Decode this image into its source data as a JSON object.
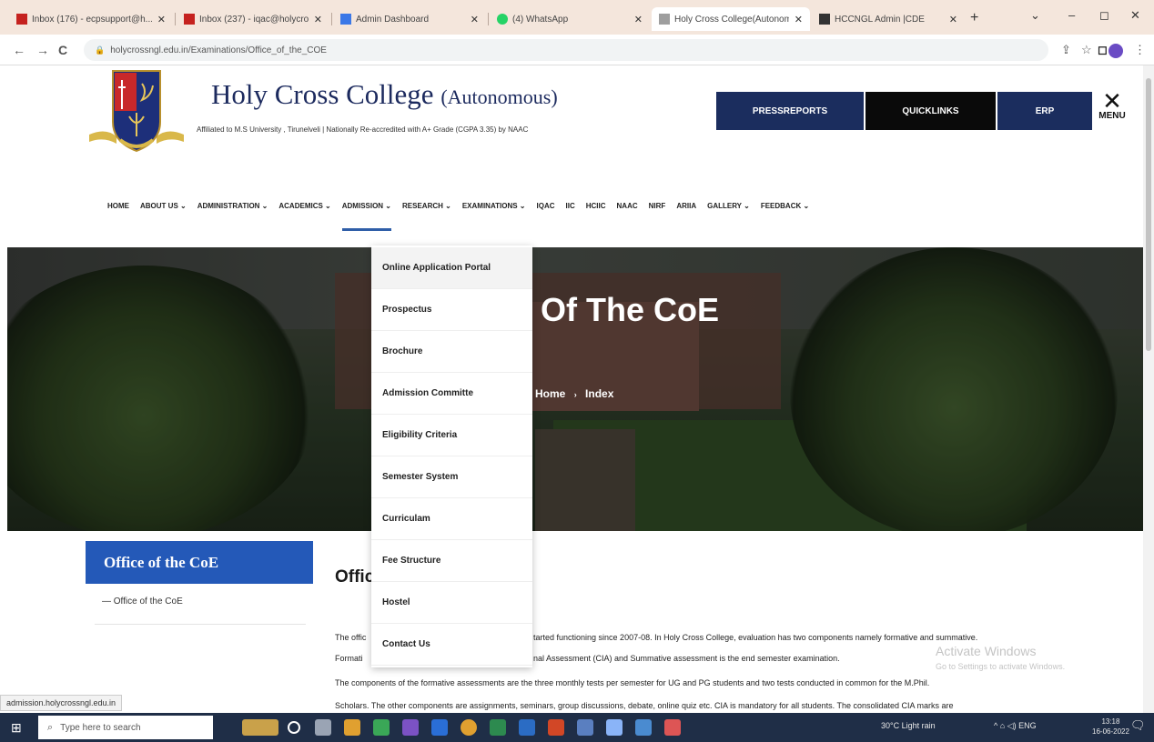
{
  "browser": {
    "tabs": [
      {
        "title": "Inbox (176) - ecpsupport@h...",
        "favicon_color": "#c5221f",
        "active": false
      },
      {
        "title": "Inbox (237) - iqac@holycross...",
        "favicon_color": "#c5221f",
        "active": false
      },
      {
        "title": "Admin Dashboard",
        "favicon_color": "#3b78e7",
        "active": false
      },
      {
        "title": "(4) WhatsApp",
        "favicon_color": "#25d366",
        "active": false
      },
      {
        "title": "Holy Cross College(Autonom...",
        "favicon_color": "#9e9e9e",
        "active": true
      },
      {
        "title": "HCCNGL Admin |CDE",
        "favicon_color": "#333333",
        "active": false
      }
    ],
    "tab_close": "✕",
    "new_tab": "+",
    "window_controls": {
      "dropdown": "⌄",
      "minimize": "–",
      "maximize": "◻",
      "close": "✕"
    },
    "nav": {
      "back": "←",
      "forward": "→",
      "reload": "C"
    },
    "url": "holycrossngl.edu.in/Examinations/Office_of_the_COE",
    "status_url": "admission.holycrossngl.edu.in"
  },
  "site": {
    "title_main": "Holy Cross College",
    "title_suffix": "(Autonomous)",
    "affiliation": "Affiliated to M.S University , Tirunelveli | Nationally Re-accredited with A+ Grade (CGPA 3.35) by NAAC",
    "top_buttons": [
      "PRESSREPORTS",
      "QUICKLINKS",
      "ERP"
    ],
    "top_button_colors": [
      "#1b2d5e",
      "#0a0a0a",
      "#1b2d5e"
    ],
    "menu_icon": "✕",
    "menu_label": "MENU"
  },
  "nav": {
    "items": [
      "HOME",
      "ABOUT US ⌄",
      "ADMINISTRATION ⌄",
      "ACADEMICS ⌄",
      "ADMISSION ⌄",
      "RESEARCH ⌄",
      "EXAMINATIONS ⌄",
      "IQAC",
      "IIC",
      "HCIIC",
      "NAAC",
      "NIRF",
      "ARIIA",
      "GALLERY ⌄",
      "FEEDBACK ⌄"
    ],
    "active_index": 4
  },
  "dropdown": {
    "items": [
      "Online Application Portal",
      "Prospectus",
      "Brochure",
      "Admission Committe",
      "Eligibility Criteria",
      "Semester System",
      "Curriculam",
      "Fee Structure",
      "Hostel",
      "Contact Us"
    ],
    "hover_index": 0
  },
  "hero": {
    "title": "Of The CoE",
    "crumb_home": "Home",
    "crumb_sep": "›",
    "crumb_current": "Index"
  },
  "sidebar": {
    "heading": "Office of the CoE",
    "item": "— Office of the CoE"
  },
  "content": {
    "heading": "Offic",
    "para1_a": "The offic",
    "para1_b": "tarted functioning since 2007-08. In Holy Cross College, evaluation has two components namely formative and summative.",
    "para2_a": "Formati",
    "para2_b": "nal Assessment (CIA) and Summative assessment is the end semester examination.",
    "para3": "The components of the formative assessments are the three monthly tests per semester for UG and PG students and two tests conducted in common for the M.Phil.",
    "para4": "Scholars. The other components are assignments, seminars, group discussions, debate, online quiz etc. CIA is mandatory for all students. The consolidated CIA marks are"
  },
  "windows_watermark": {
    "line1": "Activate Windows",
    "line2": "Go to Settings to activate Windows."
  },
  "taskbar": {
    "search_placeholder": "Type here to search",
    "weather": "30°C  Light rain",
    "tray": "^  ⌂  ◁)  ENG",
    "time": "13:18",
    "date": "16-06-2022",
    "app_colors": [
      "#c9a14a",
      "#ffffff",
      "#9aa4b4",
      "#3b78e7",
      "#3aa757",
      "#7b52c4",
      "#2a6ed6",
      "#e0a030",
      "#2d8a4f",
      "#2b6cc4",
      "#d24726",
      "#5a7fc0",
      "#8ab4f8",
      "#4a8bd0",
      "#d55"
    ]
  }
}
